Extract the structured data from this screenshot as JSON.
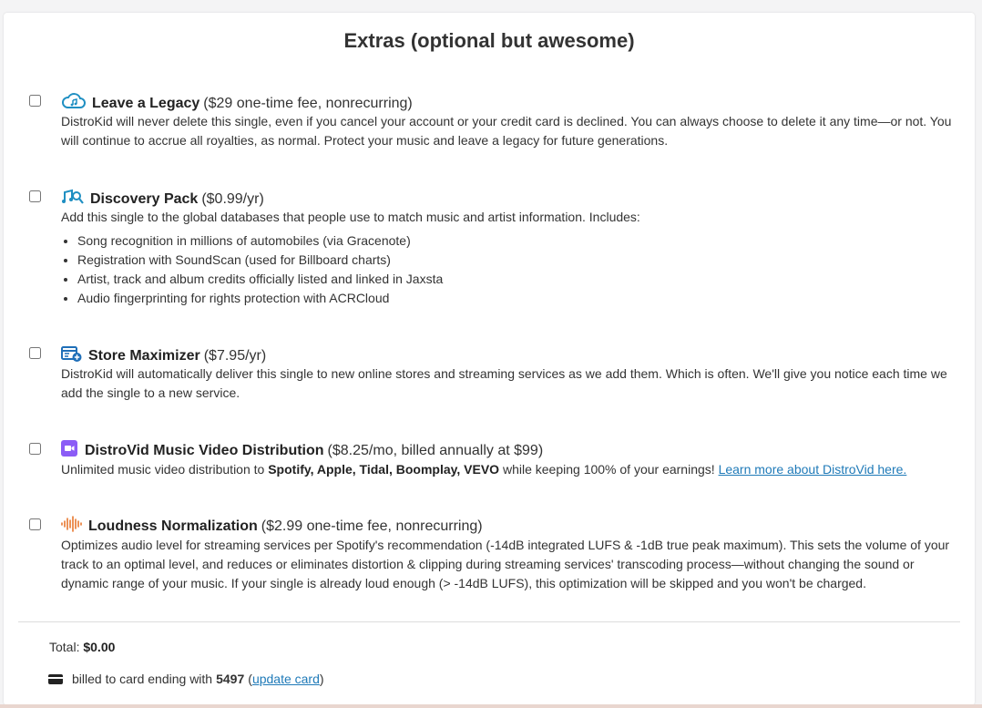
{
  "title": "Extras (optional but awesome)",
  "extras": [
    {
      "name": "Leave a Legacy",
      "price": "($29 one-time fee, nonrecurring)",
      "icon": "cloud-music-icon",
      "description": "DistroKid will never delete this single, even if you cancel your account or your credit card is declined. You can always choose to delete it any time—or not. You will continue to accrue all royalties, as normal. Protect your music and leave a legacy for future generations."
    },
    {
      "name": "Discovery Pack",
      "price": "($0.99/yr)",
      "icon": "music-search-icon",
      "description": "Add this single to the global databases that people use to match music and artist information. Includes:",
      "bullets": [
        "Song recognition in millions of automobiles (via Gracenote)",
        "Registration with SoundScan (used for Billboard charts)",
        "Artist, track and album credits officially listed and linked in Jaxsta",
        "Audio fingerprinting for rights protection with ACRCloud"
      ]
    },
    {
      "name": "Store Maximizer",
      "price": "($7.95/yr)",
      "icon": "store-add-icon",
      "description": "DistroKid will automatically deliver this single to new online stores and streaming services as we add them. Which is often. We'll give you notice each time we add the single to a new service."
    },
    {
      "name": "DistroVid Music Video Distribution",
      "price": "($8.25/mo, billed annually at $99)",
      "icon": "video-camera-icon",
      "description_pre": "Unlimited music video distribution to ",
      "description_bold": "Spotify, Apple, Tidal, Boomplay, VEVO",
      "description_post": " while keeping 100% of your earnings! ",
      "link": "Learn more about DistroVid here."
    },
    {
      "name": "Loudness Normalization",
      "price": "($2.99 one-time fee, nonrecurring)",
      "icon": "waveform-icon",
      "description": "Optimizes audio level for streaming services per Spotify's recommendation (-14dB integrated LUFS & -1dB true peak maximum). This sets the volume of your track to an optimal level, and reduces or eliminates distortion & clipping during streaming services' transcoding process—without changing the sound or dynamic range of your music. If your single is already loud enough (> -14dB LUFS), this optimization will be skipped and you won't be charged."
    }
  ],
  "total": {
    "label": "Total:",
    "value": "$0.00"
  },
  "billing": {
    "pre": "billed to card ending with ",
    "card_last4": "5497",
    "open_paren": "(",
    "link": "update card",
    "close_paren": ")"
  },
  "colors": {
    "legacy_icon": "#1f8fc2",
    "discovery_icon": "#1f8fc2",
    "store_icon": "#1f6fb8",
    "distrovid_icon": "#8b5cf6",
    "loudness_icon": "#e8772e",
    "link": "#1f7ab8"
  }
}
